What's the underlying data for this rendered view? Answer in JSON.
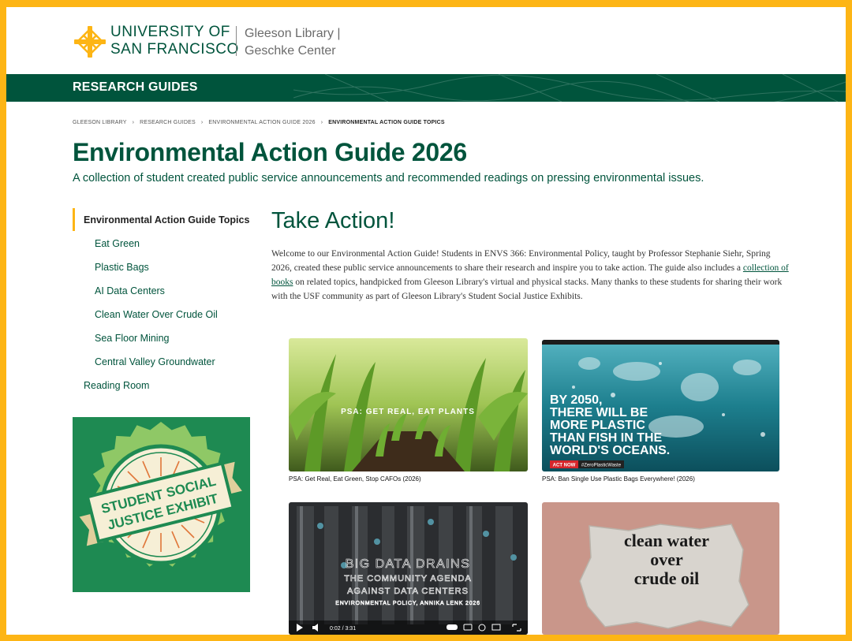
{
  "header": {
    "logo_line1": "UNIVERSITY OF",
    "logo_line2": "SAN FRANCISCO",
    "library_line1": "Gleeson Library |",
    "library_line2": "Geschke Center"
  },
  "nav_bar": {
    "title": "RESEARCH GUIDES"
  },
  "breadcrumb": {
    "items": [
      "GLEESON LIBRARY",
      "RESEARCH GUIDES",
      "ENVIRONMENTAL ACTION GUIDE 2026",
      "ENVIRONMENTAL ACTION GUIDE TOPICS"
    ],
    "separator": "›"
  },
  "page": {
    "title": "Environmental Action Guide 2026",
    "subtitle": "A collection of student created public service announcements and recommended readings on pressing environmental issues."
  },
  "sidebar": {
    "items": [
      {
        "label": "Environmental Action Guide Topics"
      },
      {
        "label": "Eat Green"
      },
      {
        "label": "Plastic Bags"
      },
      {
        "label": "AI Data Centers"
      },
      {
        "label": "Clean Water Over Crude Oil"
      },
      {
        "label": "Sea Floor Mining"
      },
      {
        "label": "Central Valley Groundwater"
      },
      {
        "label": "Reading Room"
      }
    ]
  },
  "exhibit": {
    "line1": "STUDENT SOCIAL",
    "line2": "JUSTICE EXHIBIT"
  },
  "main": {
    "heading": "Take Action!",
    "intro_before": "Welcome to our Environmental Action Guide! Students in ENVS 366: Environmental Policy, taught by Professor Stephanie Siehr, Spring 2026, created these public service announcements to share their research and inspire you to take action. The guide also includes a ",
    "intro_link": "collection of books",
    "intro_after": " on related topics, handpicked from Gleeson Library's virtual and physical stacks. Many thanks to these students for sharing their work with the USF community as part of Gleeson Library's Student Social Justice Exhibits."
  },
  "cards": [
    {
      "overlay": "PSA: GET REAL, EAT PLANTS",
      "caption": "PSA: Get Real, Eat Green, Stop CAFOs (2026)"
    },
    {
      "overlay_lines": [
        "BY 2050,",
        "THERE WILL BE",
        "MORE PLASTIC",
        "THAN FISH IN THE",
        "WORLD'S OCEANS."
      ],
      "badge_act": "ACT NOW",
      "badge_tag": "#ZeroPlasticWaste",
      "caption": "PSA: Ban Single Use Plastic Bags Everywhere! (2026)"
    },
    {
      "overlay_lines": [
        "BIG DATA DRAINS",
        "THE COMMUNITY AGENDA",
        "AGAINST DATA CENTERS",
        "ENVIRONMENTAL POLICY, ANNIKA LENK 2026"
      ],
      "video_time": "0:02 / 3:31"
    },
    {
      "overlay_lines": [
        "clean water",
        "over",
        "crude oil"
      ]
    }
  ],
  "colors": {
    "usf_green": "#00543c",
    "usf_gold": "#fdb515"
  }
}
